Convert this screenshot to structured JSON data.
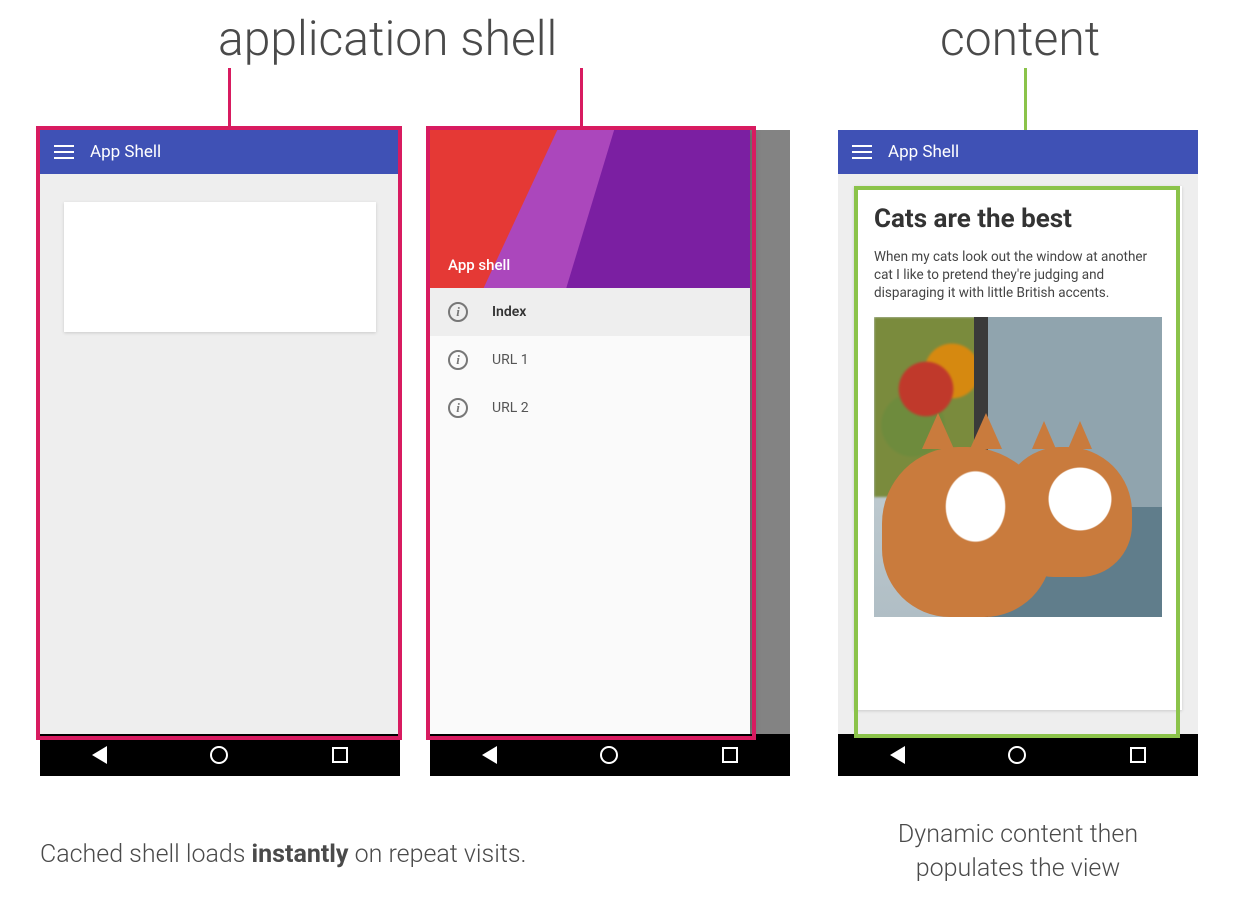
{
  "labels": {
    "shell": "application shell",
    "content": "content"
  },
  "captions": {
    "left_pre": "Cached shell loads ",
    "left_bold": "instantly",
    "left_post": " on repeat visits.",
    "right": "Dynamic content then populates the view"
  },
  "appbar": {
    "title": "App Shell"
  },
  "drawer": {
    "header_title": "App shell",
    "items": [
      {
        "label": "Index",
        "active": true
      },
      {
        "label": "URL 1",
        "active": false
      },
      {
        "label": "URL 2",
        "active": false
      }
    ]
  },
  "article": {
    "title": "Cats are the best",
    "body": "When my cats look out the window at another cat I like to pretend they're judging and disparaging it with little British accents."
  },
  "colors": {
    "pink": "#d81b60",
    "green": "#8bc34a",
    "appbar": "#3f51b5"
  }
}
